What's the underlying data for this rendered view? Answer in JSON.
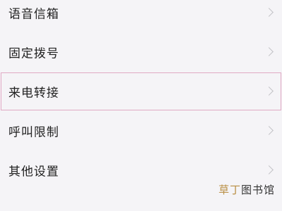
{
  "settings": {
    "items": [
      {
        "label": "语音信箱"
      },
      {
        "label": "固定拨号"
      },
      {
        "label": "来电转接"
      },
      {
        "label": "呼叫限制"
      },
      {
        "label": "其他设置"
      }
    ],
    "chevron_icon": "chevron-right-icon",
    "highlight_color": "#e0a9c4"
  },
  "watermark": {
    "part1": "草丁",
    "part2": "图书馆",
    "colors": [
      "#b98e43",
      "#353535"
    ]
  }
}
